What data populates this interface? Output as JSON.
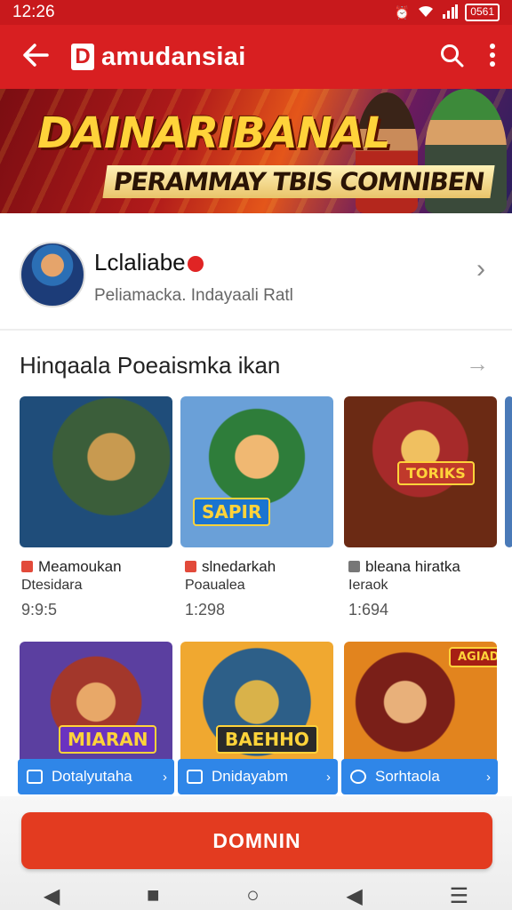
{
  "status": {
    "time": "12:26",
    "battery": "0561"
  },
  "appbar": {
    "title": "amudansiai"
  },
  "banner": {
    "title": "DAINARIBANAL",
    "subtitle": "PERAMMAY TBIS COMNIBEN"
  },
  "channel": {
    "name": "Lclaliabe",
    "description": "Peliamacka.  Indayaali Ratl"
  },
  "section": {
    "title": "Hinqaala Poeaismka ikan"
  },
  "videos": [
    {
      "title": "Meamoukan",
      "subtitle": "Dtesidara",
      "count": "9:9:5"
    },
    {
      "title": "slnedarkah",
      "subtitle": "Poaualea",
      "count": "1:298",
      "badge": "SAPIR"
    },
    {
      "title": "bleana hiratka",
      "subtitle": "Ieraok",
      "count": "1:694",
      "badge": "TORIKS"
    }
  ],
  "row2": [
    {
      "badge": "MIARAN",
      "chip": "Dotalyutaha"
    },
    {
      "badge": "BAEHHO",
      "chip": "Dnidayabm"
    },
    {
      "badge": "AGIADEA",
      "chip": "Sorhtaola"
    }
  ],
  "cta": {
    "label": "DOMNIN"
  },
  "colors": {
    "primary": "#d81f21",
    "cta": "#e33b20",
    "chip": "#2f86e8"
  }
}
